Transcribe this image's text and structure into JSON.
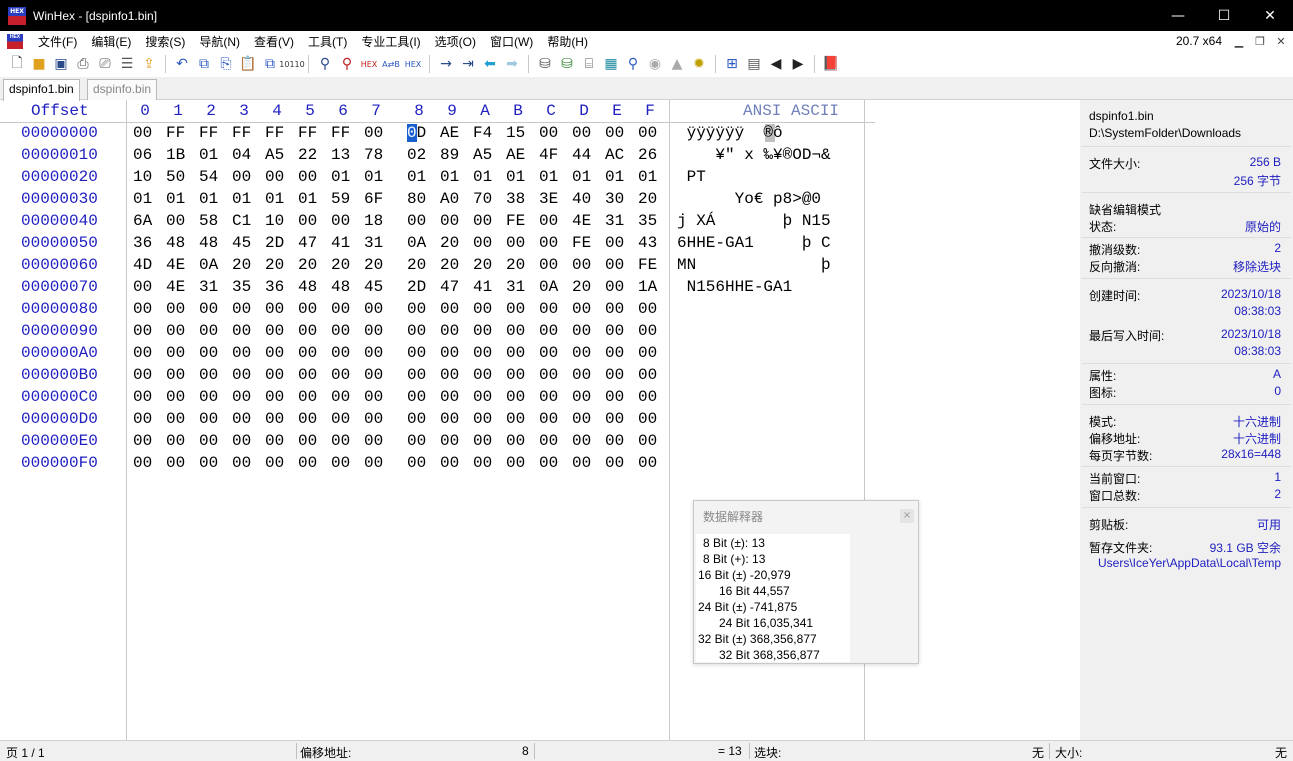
{
  "window": {
    "title": "WinHex - [dspinfo1.bin]",
    "minimize": "—",
    "maximize": "☐",
    "close": "✕"
  },
  "app_logo": "HEX",
  "menu": {
    "items": [
      "文件(F)",
      "编辑(E)",
      "搜索(S)",
      "导航(N)",
      "查看(V)",
      "工具(T)",
      "专业工具(I)",
      "选项(O)",
      "窗口(W)",
      "帮助(H)"
    ],
    "zoom": "20.7 x64"
  },
  "toolbar_icons": [
    "new-file-icon",
    "open-folder-icon",
    "save-icon",
    "print-icon",
    "print-preview-icon",
    "properties-icon",
    "export-icon",
    "sep",
    "undo-icon",
    "copy-block-icon",
    "copy-icon",
    "paste-icon",
    "paste-special-icon",
    "hex-convert-icon",
    "sep",
    "find-text-icon",
    "find-hex-icon",
    "replace-text-icon",
    "replace-hex-icon",
    "replace-both-icon",
    "sep",
    "goto-offset-icon",
    "goto-sector-icon",
    "back-icon",
    "forward-icon",
    "sep",
    "open-disk-icon",
    "clone-disk-icon",
    "disk-editor-icon",
    "ram-editor-icon",
    "analyze-icon",
    "snapshot-icon",
    "flag-icon",
    "interpreter-icon",
    "sep",
    "calculator-icon",
    "table-icon",
    "prev-icon",
    "next-icon",
    "sep",
    "help-book-icon"
  ],
  "tabs": [
    {
      "label": "dspinfo1.bin"
    },
    {
      "label": "dspinfo.bin"
    }
  ],
  "hex": {
    "offset_header": "Offset",
    "ascii_header": "ANSI ASCII",
    "columns": [
      "0",
      "1",
      "2",
      "3",
      "4",
      "5",
      "6",
      "7",
      "8",
      "9",
      "A",
      "B",
      "C",
      "D",
      "E",
      "F"
    ],
    "rows": [
      {
        "offset": "00000000",
        "bytes": [
          "00",
          "FF",
          "FF",
          "FF",
          "FF",
          "FF",
          "FF",
          "00",
          "0D",
          "AE",
          "F4",
          "15",
          "00",
          "00",
          "00",
          "00"
        ],
        "ascii": " ÿÿÿÿÿÿ  ®ô"
      },
      {
        "offset": "00000010",
        "bytes": [
          "06",
          "1B",
          "01",
          "04",
          "A5",
          "22",
          "13",
          "78",
          "02",
          "89",
          "A5",
          "AE",
          "4F",
          "44",
          "AC",
          "26"
        ],
        "ascii": "    ¥\" x ‰¥®OD¬&"
      },
      {
        "offset": "00000020",
        "bytes": [
          "10",
          "50",
          "54",
          "00",
          "00",
          "00",
          "01",
          "01",
          "01",
          "01",
          "01",
          "01",
          "01",
          "01",
          "01",
          "01"
        ],
        "ascii": " PT"
      },
      {
        "offset": "00000030",
        "bytes": [
          "01",
          "01",
          "01",
          "01",
          "01",
          "01",
          "59",
          "6F",
          "80",
          "A0",
          "70",
          "38",
          "3E",
          "40",
          "30",
          "20"
        ],
        "ascii": "      Yo€ p8>@0"
      },
      {
        "offset": "00000040",
        "bytes": [
          "6A",
          "00",
          "58",
          "C1",
          "10",
          "00",
          "00",
          "18",
          "00",
          "00",
          "00",
          "FE",
          "00",
          "4E",
          "31",
          "35"
        ],
        "ascii": "j XÁ       þ N15"
      },
      {
        "offset": "00000050",
        "bytes": [
          "36",
          "48",
          "48",
          "45",
          "2D",
          "47",
          "41",
          "31",
          "0A",
          "20",
          "00",
          "00",
          "00",
          "FE",
          "00",
          "43"
        ],
        "ascii": "6HHE-GA1     þ C"
      },
      {
        "offset": "00000060",
        "bytes": [
          "4D",
          "4E",
          "0A",
          "20",
          "20",
          "20",
          "20",
          "20",
          "20",
          "20",
          "20",
          "20",
          "00",
          "00",
          "00",
          "FE"
        ],
        "ascii": "MN             þ"
      },
      {
        "offset": "00000070",
        "bytes": [
          "00",
          "4E",
          "31",
          "35",
          "36",
          "48",
          "48",
          "45",
          "2D",
          "47",
          "41",
          "31",
          "0A",
          "20",
          "00",
          "1A"
        ],
        "ascii": " N156HHE-GA1"
      },
      {
        "offset": "00000080",
        "bytes": [
          "00",
          "00",
          "00",
          "00",
          "00",
          "00",
          "00",
          "00",
          "00",
          "00",
          "00",
          "00",
          "00",
          "00",
          "00",
          "00"
        ],
        "ascii": ""
      },
      {
        "offset": "00000090",
        "bytes": [
          "00",
          "00",
          "00",
          "00",
          "00",
          "00",
          "00",
          "00",
          "00",
          "00",
          "00",
          "00",
          "00",
          "00",
          "00",
          "00"
        ],
        "ascii": ""
      },
      {
        "offset": "000000A0",
        "bytes": [
          "00",
          "00",
          "00",
          "00",
          "00",
          "00",
          "00",
          "00",
          "00",
          "00",
          "00",
          "00",
          "00",
          "00",
          "00",
          "00"
        ],
        "ascii": ""
      },
      {
        "offset": "000000B0",
        "bytes": [
          "00",
          "00",
          "00",
          "00",
          "00",
          "00",
          "00",
          "00",
          "00",
          "00",
          "00",
          "00",
          "00",
          "00",
          "00",
          "00"
        ],
        "ascii": ""
      },
      {
        "offset": "000000C0",
        "bytes": [
          "00",
          "00",
          "00",
          "00",
          "00",
          "00",
          "00",
          "00",
          "00",
          "00",
          "00",
          "00",
          "00",
          "00",
          "00",
          "00"
        ],
        "ascii": ""
      },
      {
        "offset": "000000D0",
        "bytes": [
          "00",
          "00",
          "00",
          "00",
          "00",
          "00",
          "00",
          "00",
          "00",
          "00",
          "00",
          "00",
          "00",
          "00",
          "00",
          "00"
        ],
        "ascii": ""
      },
      {
        "offset": "000000E0",
        "bytes": [
          "00",
          "00",
          "00",
          "00",
          "00",
          "00",
          "00",
          "00",
          "00",
          "00",
          "00",
          "00",
          "00",
          "00",
          "00",
          "00"
        ],
        "ascii": ""
      },
      {
        "offset": "000000F0",
        "bytes": [
          "00",
          "00",
          "00",
          "00",
          "00",
          "00",
          "00",
          "00",
          "00",
          "00",
          "00",
          "00",
          "00",
          "00",
          "00",
          "00"
        ],
        "ascii": ""
      }
    ]
  },
  "interpreter": {
    "title": "数据解释器",
    "close": "×",
    "lines": [
      "8 Bit (±): 13",
      "8 Bit (+): 13",
      "16 Bit (±) -20,979",
      "16 Bit 44,557",
      "24 Bit (±) -741,875",
      "24 Bit 16,035,341",
      "32 Bit (±) 368,356,877",
      "32 Bit 368,356,877"
    ]
  },
  "info": {
    "filename": "dspinfo1.bin",
    "path": "D:\\SystemFolder\\Downloads",
    "file_size_label": "文件大小:",
    "file_size_bytes": "256 B",
    "file_size_chars": "256 字节",
    "default_edit_mode": "缺省编辑模式",
    "state_label": "状态:",
    "state_value": "原始的",
    "undo_level_label": "撤消级数:",
    "undo_level_value": "2",
    "reverse_undo_label": "反向撤消:",
    "reverse_undo_value": "移除选块",
    "created_label": "创建时间:",
    "created_date": "2023/10/18",
    "created_time": "08:38:03",
    "modified_label": "最后写入时间:",
    "modified_date": "2023/10/18",
    "modified_time": "08:38:03",
    "attr_label": "属性:",
    "attr_value": "A",
    "icon_label": "图标:",
    "icon_value": "0",
    "mode_label": "模式:",
    "mode_value": "十六进制",
    "offset_label": "偏移地址:",
    "offset_value": "十六进制",
    "bpp_label": "每页字节数:",
    "bpp_value": "28x16=448",
    "cur_window_label": "当前窗口:",
    "cur_window_value": "1",
    "total_windows_label": "窗口总数:",
    "total_windows_value": "2",
    "clipboard_label": "剪贴板:",
    "clipboard_value": "可用",
    "temp_label": "暂存文件夹:",
    "temp_value": "93.1 GB 空余",
    "temp_path": "Users\\IceYer\\AppData\\Local\\Temp"
  },
  "status": {
    "page": "页 1 / 1",
    "offset_label": "偏移地址:",
    "offset_value": "8",
    "value": "= 13",
    "selection_label": "选块:",
    "selection_value": "无",
    "size_label": "大小:",
    "size_value": "无"
  },
  "colors": {
    "offset_blue": "#2020c0",
    "selection_blue": "#1a5fd0"
  }
}
